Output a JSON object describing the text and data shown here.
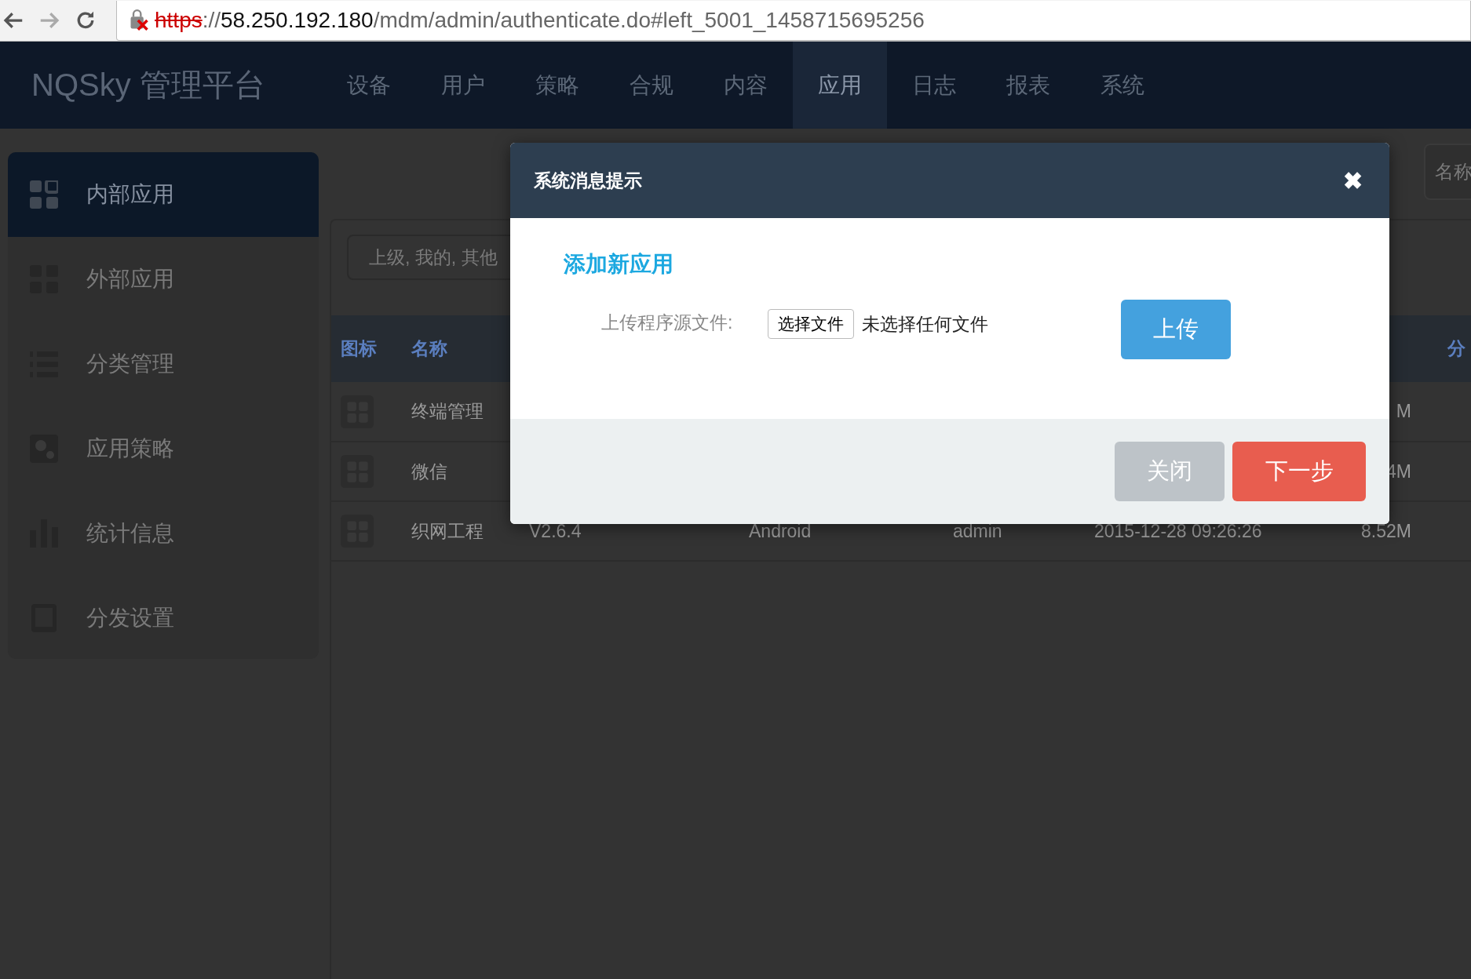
{
  "browser": {
    "url": {
      "scheme": "https",
      "separator": "://",
      "host": "58.250.192.180",
      "path": "/mdm/admin/authenticate.do#left_5001_1458715695256"
    }
  },
  "header": {
    "logo": "NQSky 管理平台",
    "nav": [
      {
        "label": "设备",
        "selected": false
      },
      {
        "label": "用户",
        "selected": false
      },
      {
        "label": "策略",
        "selected": false
      },
      {
        "label": "合规",
        "selected": false
      },
      {
        "label": "内容",
        "selected": false
      },
      {
        "label": "应用",
        "selected": true
      },
      {
        "label": "日志",
        "selected": false
      },
      {
        "label": "报表",
        "selected": false
      },
      {
        "label": "系统",
        "selected": false
      }
    ]
  },
  "sidebar": {
    "items": [
      {
        "label": "内部应用",
        "selected": true
      },
      {
        "label": "外部应用",
        "selected": false
      },
      {
        "label": "分类管理",
        "selected": false
      },
      {
        "label": "应用策略",
        "selected": false
      },
      {
        "label": "统计信息",
        "selected": false
      },
      {
        "label": "分发设置",
        "selected": false
      }
    ]
  },
  "content": {
    "name_field": {
      "placeholder": "名称"
    },
    "filter": {
      "placeholder": "上级, 我的, 其他"
    },
    "table": {
      "columns": [
        "图标",
        "名称",
        "",
        "",
        "",
        "",
        "",
        "分"
      ],
      "rows": [
        {
          "name": "终端管理",
          "cells": [
            "",
            "",
            "",
            "",
            "M"
          ]
        },
        {
          "name": "微信",
          "cells": [
            "",
            "",
            "",
            "",
            "4M"
          ]
        },
        {
          "name": "织网工程",
          "cells": [
            "V2.6.4",
            "Android",
            "admin",
            "2015-12-28 09:26:26",
            "8.52M"
          ]
        }
      ]
    }
  },
  "dialog": {
    "title": "系统消息提示",
    "close": "✖",
    "section_title": "添加新应用",
    "upload_label": "上传程序源文件:",
    "choose_button": "选择文件",
    "file_status": "未选择任何文件",
    "upload_button": "上传",
    "footer_buttons": [
      {
        "label": "关闭",
        "kind": "secondary"
      },
      {
        "label": "下一步",
        "kind": "primary"
      }
    ]
  }
}
